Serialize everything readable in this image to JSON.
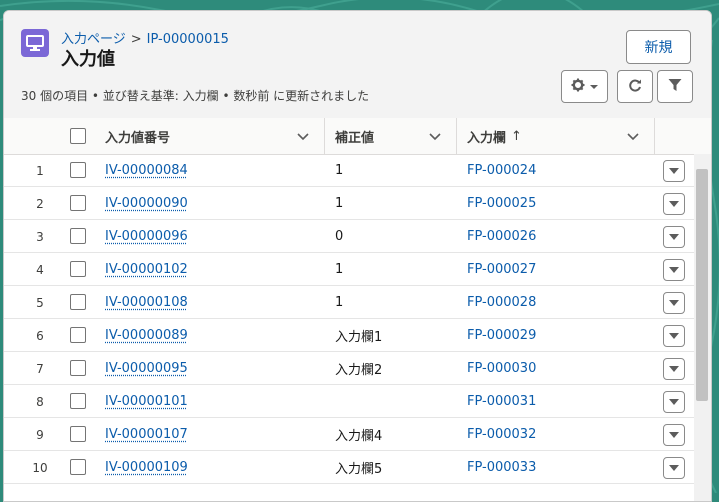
{
  "breadcrumb": {
    "parent": "入力ページ",
    "separator": ">",
    "record": "IP-00000015"
  },
  "title": "入力値",
  "actions": {
    "new_label": "新規",
    "gear_icon": "gear-icon",
    "refresh_icon": "refresh-icon",
    "filter_icon": "filter-icon"
  },
  "meta": "30 個の項目 • 並び替え基準: 入力欄 • 数秒前 に更新されました",
  "columns": {
    "col1": "入力値番号",
    "col2": "補正値",
    "col3": "入力欄",
    "col3_sort": "↑"
  },
  "rows": [
    {
      "num": "1",
      "id": "IV-00000084",
      "value": "1",
      "field": "FP-000024"
    },
    {
      "num": "2",
      "id": "IV-00000090",
      "value": "1",
      "field": "FP-000025"
    },
    {
      "num": "3",
      "id": "IV-00000096",
      "value": "0",
      "field": "FP-000026"
    },
    {
      "num": "4",
      "id": "IV-00000102",
      "value": "1",
      "field": "FP-000027"
    },
    {
      "num": "5",
      "id": "IV-00000108",
      "value": "1",
      "field": "FP-000028"
    },
    {
      "num": "6",
      "id": "IV-00000089",
      "value": "入力欄1",
      "field": "FP-000029"
    },
    {
      "num": "7",
      "id": "IV-00000095",
      "value": "入力欄2",
      "field": "FP-000030"
    },
    {
      "num": "8",
      "id": "IV-00000101",
      "value": "",
      "field": "FP-000031"
    },
    {
      "num": "9",
      "id": "IV-00000107",
      "value": "入力欄4",
      "field": "FP-000032"
    },
    {
      "num": "10",
      "id": "IV-00000109",
      "value": "入力欄5",
      "field": "FP-000033"
    }
  ],
  "colors": {
    "accent": "#0b5cab",
    "object_icon": "#7b68d6"
  }
}
